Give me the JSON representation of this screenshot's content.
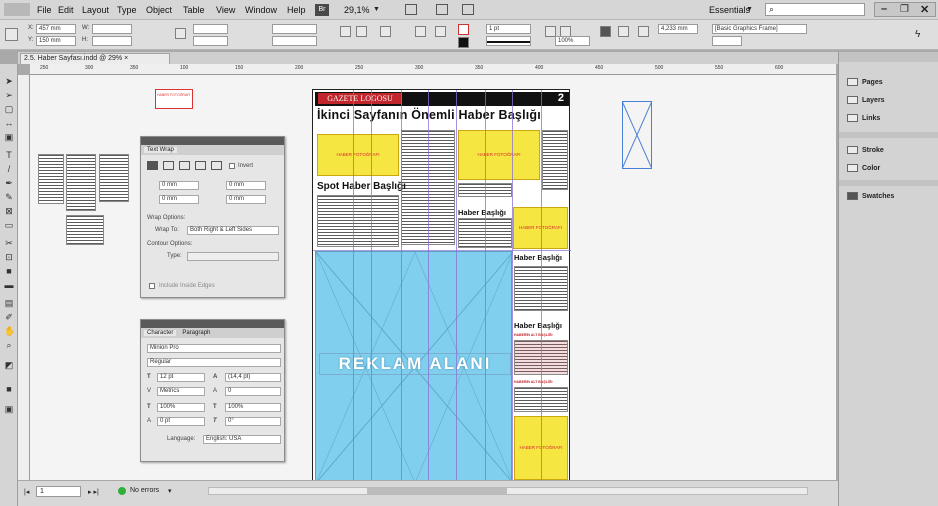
{
  "menu": [
    "File",
    "Edit",
    "Layout",
    "Type",
    "Object",
    "Table",
    "View",
    "Window",
    "Help"
  ],
  "app_badge": "Br",
  "zoom": "29,1%",
  "workspace": "Essentials",
  "control": {
    "x": "457 mm",
    "y": "150 mm",
    "w_label": "W:",
    "h_label": "H:",
    "x_label": "X:",
    "y_label": "Y:",
    "stroke_weight": "1 pt",
    "scale": "100%",
    "width_mm": "4,233 mm",
    "frame_style": "[Basic Graphics Frame]"
  },
  "doc_tab": "2.5. Haber Sayfası.indd @ 29%",
  "ruler_h": [
    "250",
    "300",
    "350",
    "400",
    "450",
    "500",
    "550",
    "600",
    "650",
    "100",
    "150",
    "200",
    "250",
    "300",
    "350",
    "400",
    "450",
    "500",
    "550",
    "600",
    "650"
  ],
  "right_panel": {
    "items": [
      "Pages",
      "Layers",
      "Links",
      "Stroke",
      "Color",
      "Swatches"
    ]
  },
  "text_wrap": {
    "tab": "Text Wrap",
    "invert": "Invert",
    "top": "0 mm",
    "bottom": "0 mm",
    "left": "0 mm",
    "right": "0 mm",
    "wrap_options_label": "Wrap Options:",
    "wrap_to_label": "Wrap To:",
    "wrap_to": "Both Right & Left Sides",
    "contour_label": "Contour Options:",
    "type_label": "Type:",
    "include_edges": "Include Inside Edges"
  },
  "character": {
    "tab1": "Character",
    "tab2": "Paragraph",
    "font": "Minion Pro",
    "style": "Regular",
    "size": "12 pt",
    "leading": "(14,4 pt)",
    "kerning": "Metrics",
    "tracking": "0",
    "vscale": "100%",
    "hscale": "100%",
    "baseline": "0 pt",
    "skew": "0°",
    "language_label": "Language:",
    "language": "English: USA"
  },
  "status": {
    "page": "1",
    "errors": "No errors"
  },
  "newspaper": {
    "logo": "GAZETE LOGOSU",
    "page_number": "2",
    "headline": "İkinci Sayfanın Önemli Haber Başlığı",
    "photo_label": "HABER FOTOĞRAFI",
    "spot": "Spot Haber Başlığı",
    "news_head": "Haber Başlığı",
    "news_sub": "HABERİN ALT BAŞLIĞI",
    "ad": "REKLAM ALANI"
  },
  "pasteboard_label": "HABER FOTOĞRAFI",
  "colors": {
    "photo_yellow": "#f5e642",
    "logo_red": "#c0262c",
    "ad_blue": "#80cfef",
    "guide_purple": "#8a6fd6"
  }
}
